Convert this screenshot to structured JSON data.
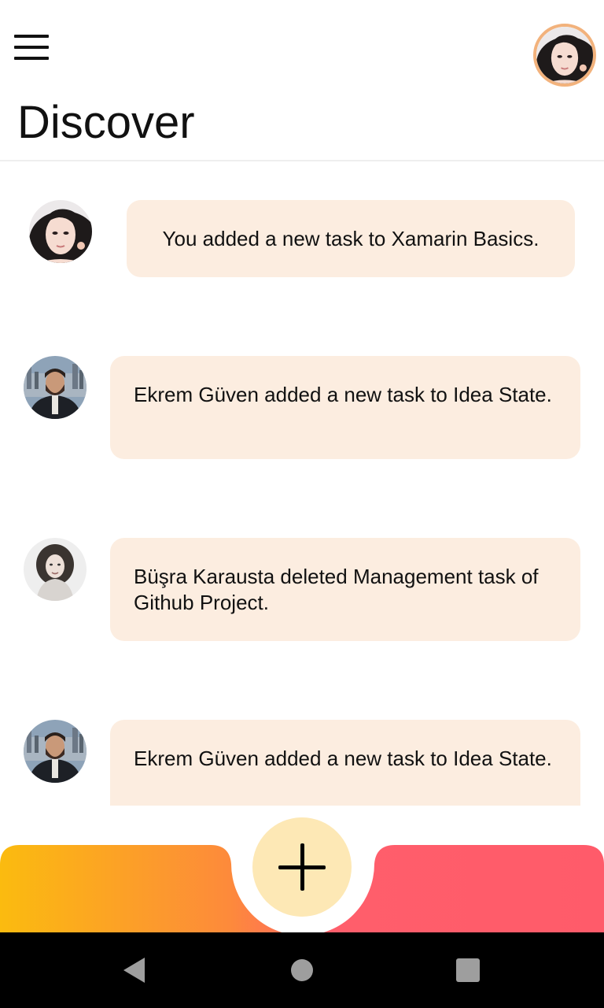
{
  "header": {
    "title": "Discover",
    "menu_icon": "hamburger-menu-icon",
    "profile_avatar": "user-avatar"
  },
  "feed": {
    "items": [
      {
        "text": "You added a new task to Xamarin Basics.",
        "avatar": "woman-portrait"
      },
      {
        "text": "Ekrem Güven added a new task to Idea State.",
        "avatar": "bearded-man-portrait"
      },
      {
        "text": "Büşra Karausta deleted Management task of Github Project.",
        "avatar": "curly-hair-woman-portrait"
      },
      {
        "text": "Ekrem Güven added a new task to Idea State.",
        "avatar": "bearded-man-portrait"
      }
    ]
  },
  "bottom_bar": {
    "add_icon": "plus-icon",
    "gradient_colors": [
      "#fbbb0f",
      "#fd8a3b",
      "#ff5e6b",
      "#ff5b6a"
    ]
  },
  "colors": {
    "bubble": "#fcede0",
    "add_button": "#fde8b5",
    "avatar_ring": "#f2b27c"
  },
  "system_nav": {
    "back": "back-triangle-icon",
    "home": "home-circle-icon",
    "recents": "recents-square-icon"
  }
}
